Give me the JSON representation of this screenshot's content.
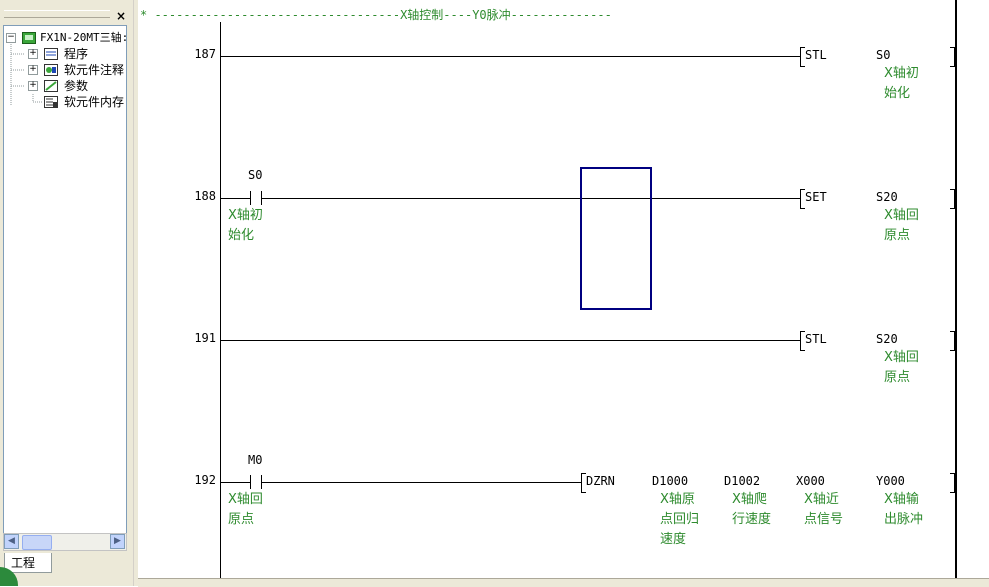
{
  "project_tree": {
    "close_label": "×",
    "root": {
      "label": "FX1N-20MT三轴:",
      "expander": "−"
    },
    "items": [
      {
        "label": "程序",
        "expander": "+"
      },
      {
        "label": "软元件注释",
        "expander": "+"
      },
      {
        "label": "参数",
        "expander": "+"
      },
      {
        "label": "软元件内存",
        "expander": ""
      }
    ],
    "tab_label": "工程"
  },
  "ladder": {
    "header_comment": "* ----------------------------------X轴控制----Y0脉冲--------------",
    "rungs": [
      {
        "step": "187",
        "contact": null,
        "instruction": "STL",
        "operands": [
          "S0"
        ],
        "operand_comments": [
          "X轴初\n始化"
        ]
      },
      {
        "step": "188",
        "contact": {
          "device": "S0",
          "comment": "X轴初\n始化"
        },
        "instruction": "SET",
        "operands": [
          "S20"
        ],
        "operand_comments": [
          "X轴回\n原点"
        ]
      },
      {
        "step": "191",
        "contact": null,
        "instruction": "STL",
        "operands": [
          "S20"
        ],
        "operand_comments": [
          "X轴回\n原点"
        ]
      },
      {
        "step": "192",
        "contact": {
          "device": "M0",
          "comment": "X轴回\n原点"
        },
        "instruction": "DZRN",
        "operands": [
          "D1000",
          "D1002",
          "X000",
          "Y000"
        ],
        "operand_comments": [
          "X轴原\n点回归\n速度",
          "X轴爬\n行速度",
          "X轴近\n点信号",
          "X轴输\n出脉冲"
        ]
      }
    ]
  },
  "colors": {
    "comment_green": "#2e8b2e",
    "cursor_navy": "#000080",
    "panel_bg": "#ece9d8"
  }
}
